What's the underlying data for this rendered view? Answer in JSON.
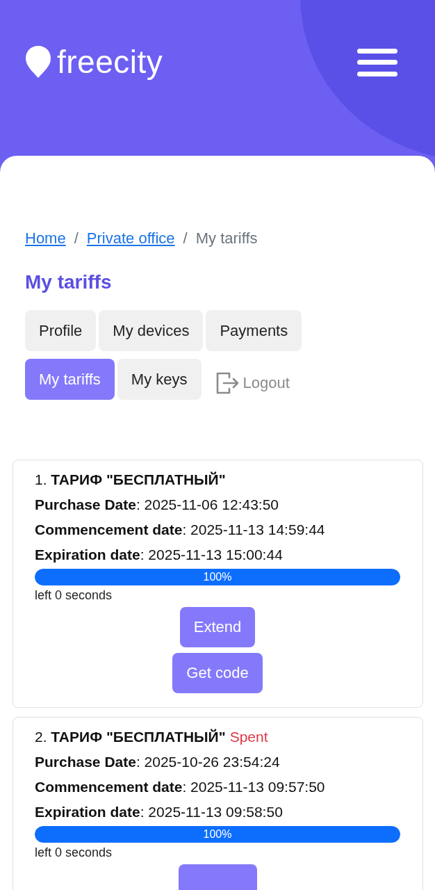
{
  "header": {
    "logo": "freecity"
  },
  "breadcrumb": [
    {
      "label": "Home",
      "link": true
    },
    {
      "separator": "/",
      "label": "Private office",
      "link": true
    },
    {
      "separator": "/",
      "label": "My tariffs",
      "link": false
    }
  ],
  "title": "My tariffs",
  "tabs": [
    {
      "label": "Profile",
      "selected": false
    },
    {
      "label": "My devices",
      "selected": false
    },
    {
      "label": "Payments",
      "selected": false
    },
    {
      "label": "My tariffs",
      "selected": true
    },
    {
      "label": "My keys",
      "selected": false
    }
  ],
  "logout": {
    "label": "Logout"
  },
  "tariffs": [
    {
      "title": "1. **ТАРИФ \"БЕСПЛАТНЫЙ\"**",
      "rows": [
        "**Purchase Date**: 2025-11-06 12:43:50",
        "**Commencement date**: 2025-11-13 14:59:44",
        "**Expiration date**: 2025-11-13 15:00:44"
      ],
      "level": 1,
      "progress_label": "100%",
      "remaining": "left 0 seconds",
      "buttons": [
        "Extend",
        "Get code"
      ]
    },
    {
      "title": "2. **ТАРИФ \"БЕСПЛАТНЫЙ\"**",
      "status": "Spent",
      "rows": [
        "**Purchase Date**: 2025-10-26 23:54:24",
        "**Commencement date**: 2025-11-13 09:57:50",
        "**Expiration date**: 2025-11-13 09:58:50"
      ],
      "level": 1,
      "progress_label": "100%",
      "remaining": "left 0 seconds",
      "cut_button": true
    }
  ]
}
